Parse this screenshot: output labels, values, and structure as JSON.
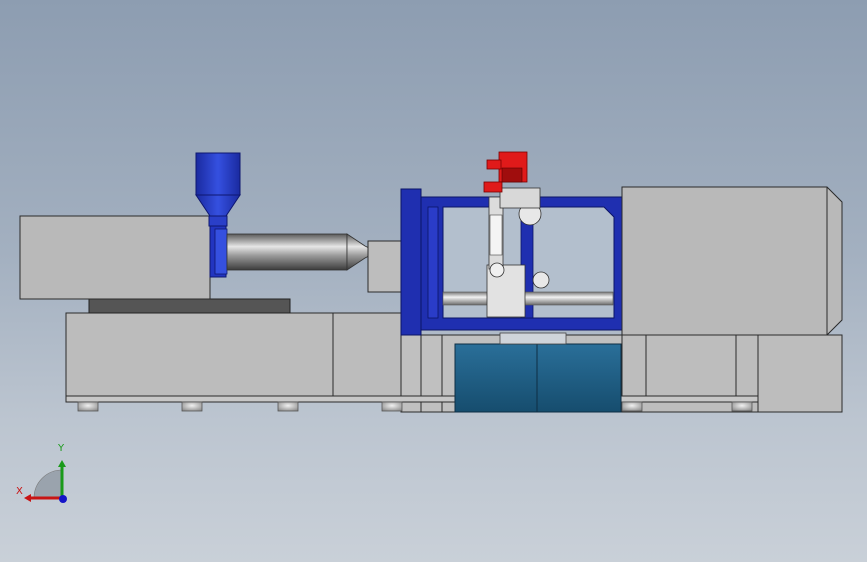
{
  "viewport": {
    "background_top": "#8d9db1",
    "background_bottom": "#c9d0d8"
  },
  "model": {
    "colors": {
      "housing": "#b9b9b9",
      "housing_edge": "#2a2a2a",
      "frame_blue": "#1f2fb0",
      "hopper_blue": "#2a3fc8",
      "robot_accent": "#e01a1a",
      "tank": "#1d5f86"
    }
  },
  "triad": {
    "x_label": "X",
    "y_label": "Y",
    "x_color": "#c81414",
    "y_color": "#1a9a1a",
    "z_color": "#1414c8"
  }
}
